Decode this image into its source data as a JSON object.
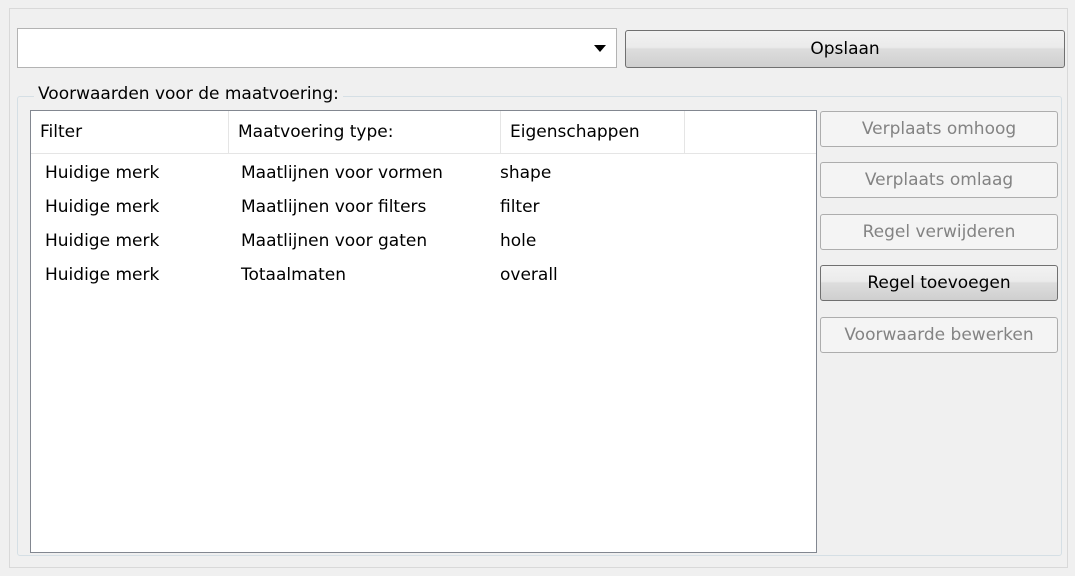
{
  "toolbar": {
    "combo_value": "",
    "save_label": "Opslaan"
  },
  "group": {
    "legend": "Voorwaarden voor de maatvoering:"
  },
  "table": {
    "columns": [
      "Filter",
      "Maatvoering type:",
      "Eigenschappen",
      ""
    ],
    "rows": [
      [
        "Huidige merk",
        "Maatlijnen voor vormen",
        "shape"
      ],
      [
        "Huidige merk",
        "Maatlijnen voor filters",
        "filter"
      ],
      [
        "Huidige merk",
        "Maatlijnen voor gaten",
        "hole"
      ],
      [
        "Huidige merk",
        "Totaalmaten",
        "overall"
      ]
    ]
  },
  "side_buttons": {
    "move_up": "Verplaats omhoog",
    "move_down": "Verplaats omlaag",
    "delete_rule": "Regel verwijderen",
    "add_rule": "Regel toevoegen",
    "edit_condition": "Voorwaarde bewerken"
  }
}
